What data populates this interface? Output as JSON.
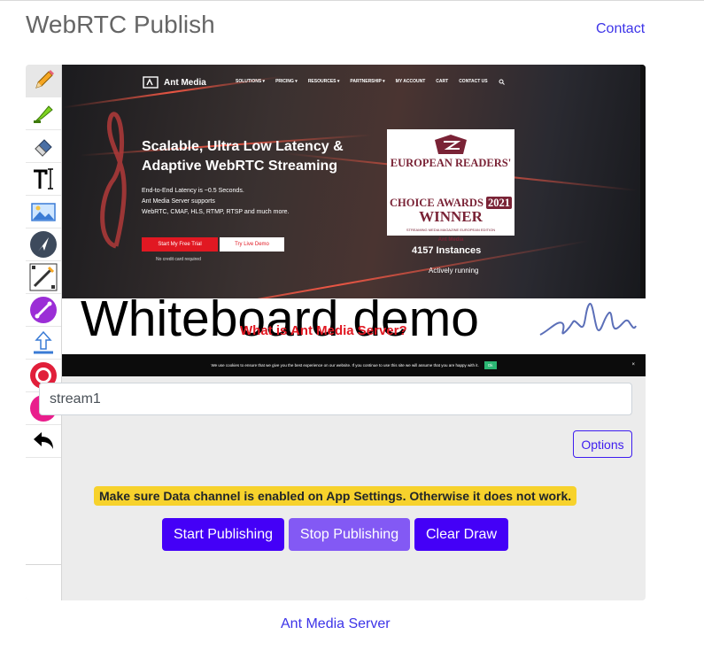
{
  "header": {
    "title": "WebRTC Publish",
    "contact_label": "Contact"
  },
  "toolbar": {
    "tools": [
      {
        "name": "pencil-icon",
        "active": true
      },
      {
        "name": "highlighter-icon"
      },
      {
        "name": "eraser-icon"
      },
      {
        "name": "text-tool-icon"
      },
      {
        "name": "image-icon"
      },
      {
        "name": "pointer-icon"
      },
      {
        "name": "line-tool-icon"
      },
      {
        "name": "arrow-tool-icon"
      },
      {
        "name": "upload-icon"
      },
      {
        "name": "record-icon"
      },
      {
        "name": "color-picker-icon"
      },
      {
        "name": "undo-icon"
      }
    ]
  },
  "hero": {
    "brand": "Ant Media",
    "nav": [
      "SOLUTIONS ▾",
      "PRICING ▾",
      "RESOURCES ▾",
      "PARTNERSHIP ▾",
      "MY ACCOUNT",
      "CART",
      "CONTACT US"
    ],
    "headline_line1": "Scalable, Ultra Low Latency &",
    "headline_line2": "Adaptive WebRTC Streaming",
    "desc_line1": "End-to-End Latency is ~0.5 Seconds.",
    "desc_line2": "Ant Media Server supports",
    "desc_line3": "WebRTC, CMAF, HLS, RTMP, RTSP and much more.",
    "primary_cta": "Start My Free Trial",
    "secondary_cta": "Try Live Demo",
    "no_card": "No credit card required",
    "award_line1": "EUROPEAN READERS'",
    "award_line2": "CHOICE AWARDS",
    "award_year": "2021",
    "award_line3": "WINNER",
    "award_sub": "STREAMING MEDIA MAGAZINE EUROPEAN EDITION",
    "award_brand": "Ant Media",
    "instances": "4157 Instances",
    "instances_status": "Actively running"
  },
  "canvas": {
    "drawn_text": "Whiteboard demo",
    "section_heading": "What is Ant Media Server?",
    "cookie_text": "We use cookies to ensure that we give you the best experience on our website. If you continue to use this site we will assume that you are happy with it.",
    "cookie_ok": "Ok",
    "cookie_close": "×"
  },
  "form": {
    "stream_id": "stream1",
    "options_label": "Options",
    "warning": "Make sure Data channel is enabled on App Settings. Otherwise it does not work.",
    "start_label": "Start Publishing",
    "stop_label": "Stop Publishing",
    "clear_label": "Clear Draw"
  },
  "footer": {
    "link": "Ant Media Server"
  },
  "colors": {
    "accent": "#4400f7",
    "accent_light": "#8359f4",
    "warning_bg": "#f7d22c",
    "link": "#3d34e8",
    "ant_red": "#e11822"
  }
}
